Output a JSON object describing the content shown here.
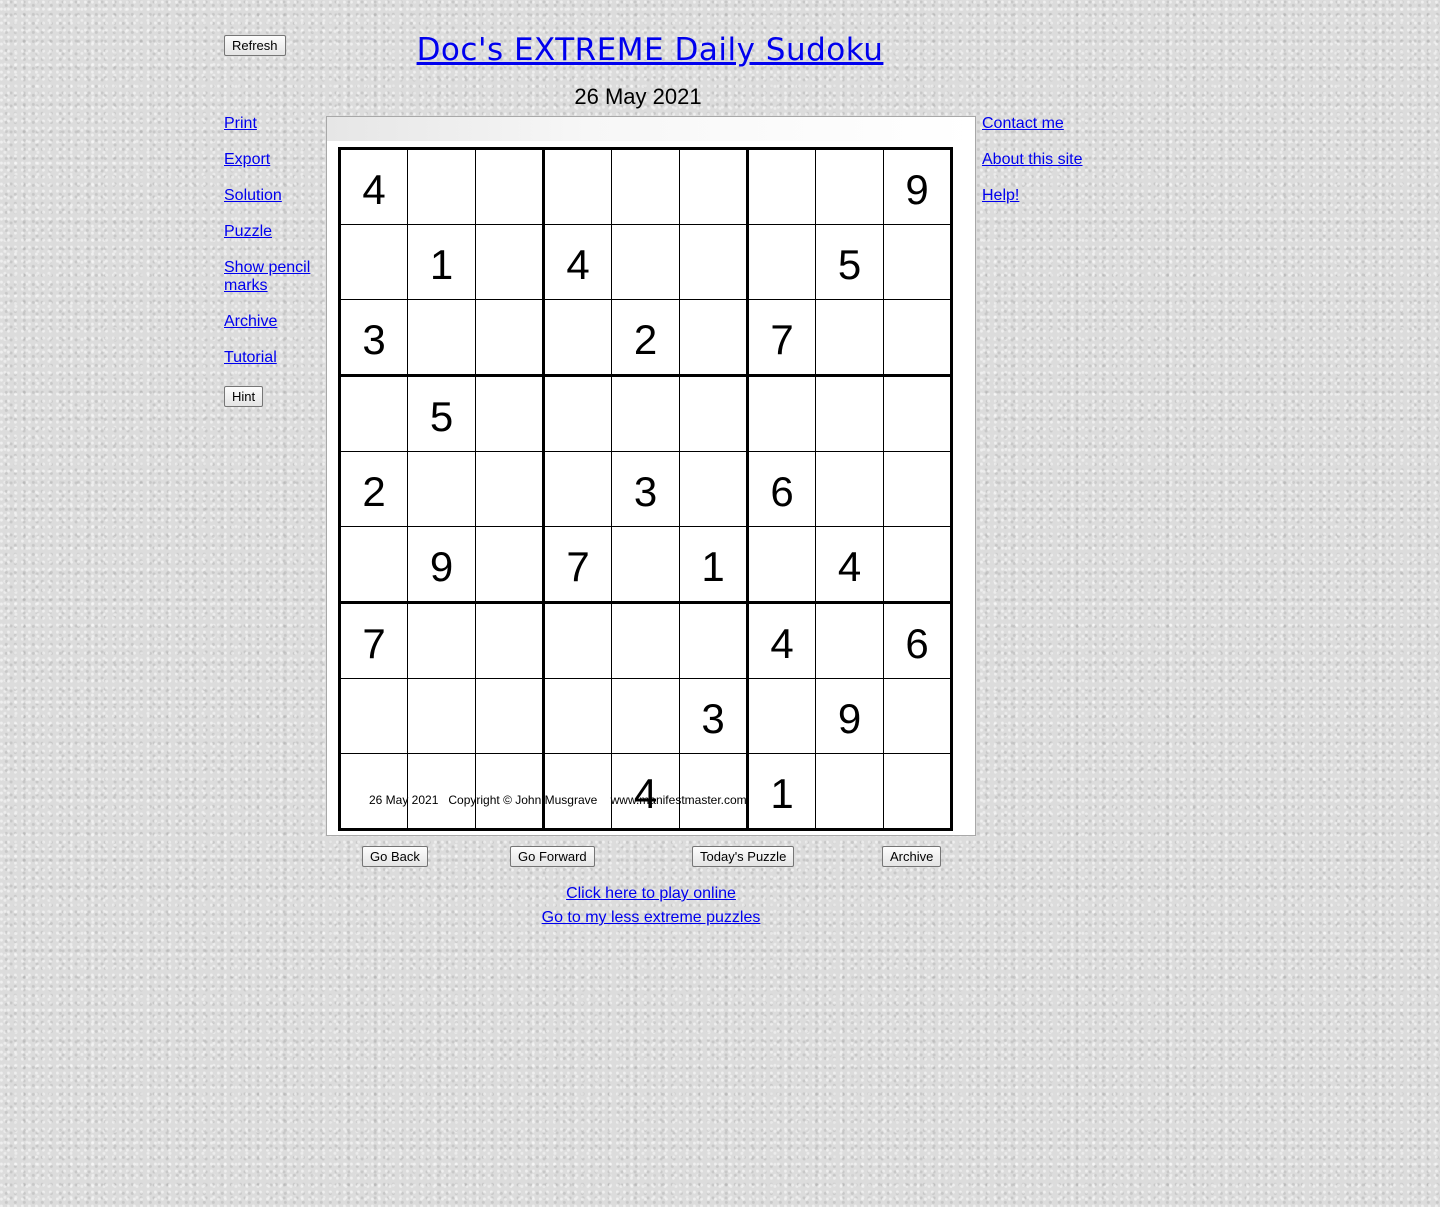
{
  "header": {
    "title": "Doc's EXTREME Daily Sudoku",
    "date": "26 May 2021",
    "refresh_label": "Refresh"
  },
  "left_nav": {
    "items": [
      "Print",
      "Export",
      "Solution",
      "Puzzle",
      "Show pencil marks",
      "Archive",
      "Tutorial"
    ],
    "hint_label": "Hint"
  },
  "right_nav": {
    "items": [
      "Contact me",
      "About this site",
      "Help!"
    ]
  },
  "puzzle": {
    "grid": [
      [
        "4",
        "",
        "",
        "",
        "",
        "",
        "",
        "",
        "9"
      ],
      [
        "",
        "1",
        "",
        "4",
        "",
        "",
        "",
        "5",
        ""
      ],
      [
        "3",
        "",
        "",
        "",
        "2",
        "",
        "7",
        "",
        ""
      ],
      [
        "",
        "5",
        "",
        "",
        "",
        "",
        "",
        "",
        ""
      ],
      [
        "2",
        "",
        "",
        "",
        "3",
        "",
        "6",
        "",
        ""
      ],
      [
        "",
        "9",
        "",
        "7",
        "",
        "1",
        "",
        "4",
        ""
      ],
      [
        "7",
        "",
        "",
        "",
        "",
        "",
        "4",
        "",
        "6"
      ],
      [
        "",
        "",
        "",
        "",
        "",
        "3",
        "",
        "9",
        ""
      ],
      [
        "",
        "",
        "",
        "",
        "4",
        "",
        "1",
        "",
        ""
      ]
    ],
    "footer": "26 May 2021   Copyright © John Musgrave    www.manifestmaster.com"
  },
  "nav_buttons": {
    "go_back": "Go Back",
    "go_forward": "Go Forward",
    "todays_puzzle": "Today's Puzzle",
    "archive": "Archive"
  },
  "bottom_links": {
    "play_online": "Click here to play online",
    "less_extreme": "Go to my less extreme puzzles"
  },
  "colors": {
    "link": "#0000ee",
    "panel_background": "#ffffff",
    "grid_line": "#000000"
  }
}
